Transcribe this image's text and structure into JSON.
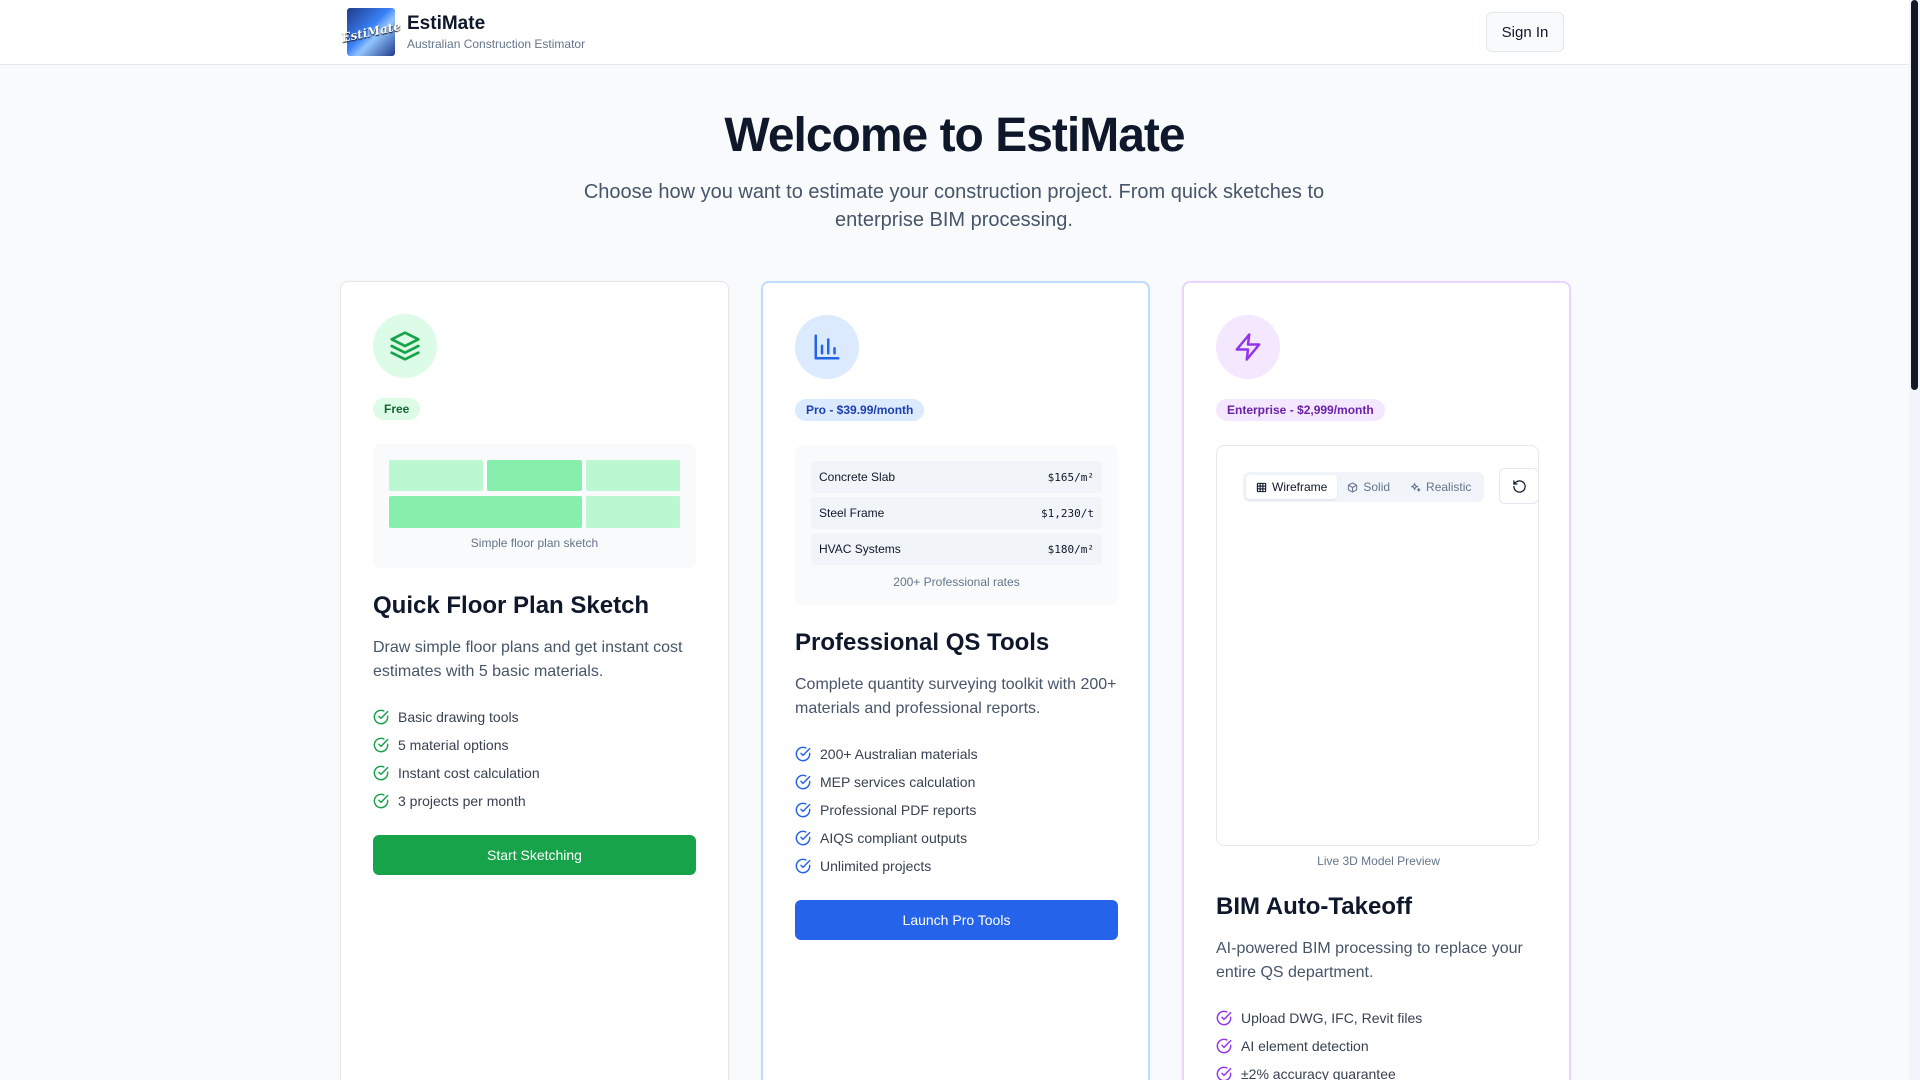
{
  "header": {
    "logo_text": "EstiMate",
    "brand_name": "EstiMate",
    "brand_subtitle": "Australian Construction Estimator",
    "signin_label": "Sign In"
  },
  "hero": {
    "title": "Welcome to EstiMate",
    "subtitle": "Choose how you want to estimate your construction project. From quick sketches to enterprise BIM processing."
  },
  "cards": [
    {
      "icon": "layers-icon",
      "accent": "#16a34a",
      "badge": "Free",
      "preview_caption": "Simple floor plan sketch",
      "title": "Quick Floor Plan Sketch",
      "description": "Draw simple floor plans and get instant cost estimates with 5 basic materials.",
      "features": [
        "Basic drawing tools",
        "5 material options",
        "Instant cost calculation",
        "3 projects per month"
      ],
      "cta": "Start Sketching"
    },
    {
      "icon": "bar-chart-icon",
      "accent": "#2563eb",
      "badge": "Pro - $39.99/month",
      "rates": [
        {
          "name": "Concrete Slab",
          "value": "$165/m²"
        },
        {
          "name": "Steel Frame",
          "value": "$1,230/t"
        },
        {
          "name": "HVAC Systems",
          "value": "$180/m²"
        }
      ],
      "preview_caption": "200+ Professional rates",
      "title": "Professional QS Tools",
      "description": "Complete quantity surveying toolkit with 200+ materials and professional reports.",
      "features": [
        "200+ Australian materials",
        "MEP services calculation",
        "Professional PDF reports",
        "AIQS compliant outputs",
        "Unlimited projects"
      ],
      "cta": "Launch Pro Tools"
    },
    {
      "icon": "lightning-icon",
      "accent": "#9333ea",
      "badge": "Enterprise - $2,999/month",
      "view_modes": [
        "Wireframe",
        "Solid",
        "Realistic"
      ],
      "active_view": "Wireframe",
      "preview_caption": "Live 3D Model Preview",
      "title": "BIM Auto-Takeoff",
      "description": "AI-powered BIM processing to replace your entire QS department.",
      "features": [
        "Upload DWG, IFC, Revit files",
        "AI element detection",
        "±2% accuracy guarantee"
      ]
    }
  ],
  "colors": {
    "free_green": "#16a34a",
    "pro_blue": "#2563eb",
    "enterprise_purple": "#9333ea"
  }
}
